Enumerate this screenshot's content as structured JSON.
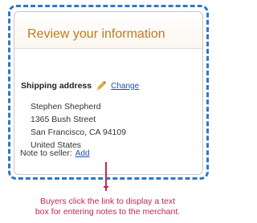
{
  "panel": {
    "title": "Review your information"
  },
  "shipping": {
    "label": "Shipping address",
    "edit_icon": "pencil-icon",
    "change_link": "Change",
    "address_lines": [
      "Stephen Shepherd",
      "1365 Bush Street",
      "San Francisco, CA 94109",
      "United States"
    ]
  },
  "note": {
    "label": "Note to seller:",
    "add_link": "Add"
  },
  "callout": {
    "line1": "Buyers click the link to display a text",
    "line2": "box for entering notes to the merchant."
  },
  "colors": {
    "frame_border": "#2e78c2",
    "title": "#c07a1d",
    "link": "#1a55b0",
    "callout": "#c7264a"
  }
}
